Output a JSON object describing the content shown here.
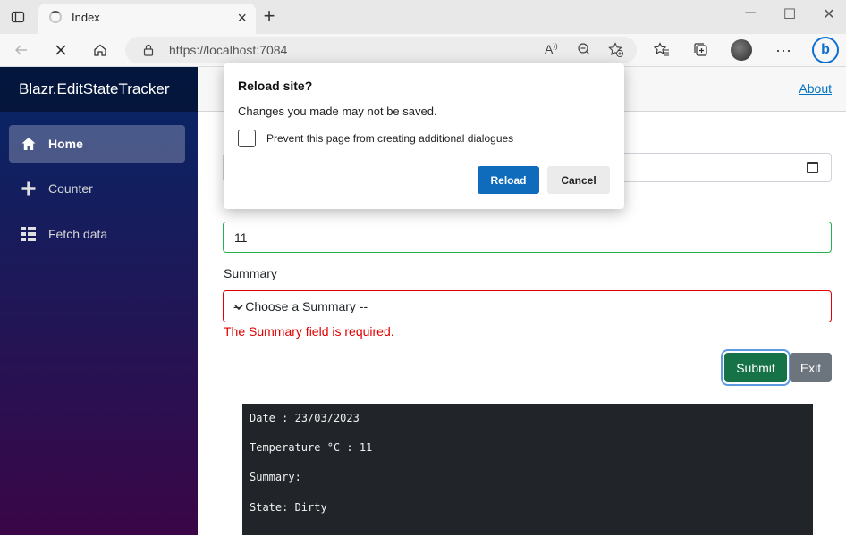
{
  "browser": {
    "tab_title": "Index",
    "url": "https://localhost:7084",
    "window_controls": {
      "minimize": "─",
      "maximize": "☐",
      "close": "✕"
    }
  },
  "app": {
    "brand": "Blazr.EditStateTracker",
    "nav": [
      {
        "label": "Home",
        "icon": "home-icon",
        "active": true
      },
      {
        "label": "Counter",
        "icon": "plus-icon",
        "active": false
      },
      {
        "label": "Fetch data",
        "icon": "list-icon",
        "active": false
      }
    ],
    "about_link": "About"
  },
  "form": {
    "temperature_value": "11",
    "summary_label": "Summary",
    "summary_selected": "-- Choose a Summary --",
    "summary_error": "The Summary field is required.",
    "submit_label": "Submit",
    "exit_label": "Exit"
  },
  "state_output": {
    "date_line": "Date : 23/03/2023",
    "temperature_line": "Temperature °C : 11",
    "summary_line": "Summary:",
    "state_line": "State: Dirty"
  },
  "dialog": {
    "title": "Reload site?",
    "message": "Changes you made may not be saved.",
    "checkbox_label": "Prevent this page from creating additional dialogues",
    "reload_label": "Reload",
    "cancel_label": "Cancel"
  },
  "colors": {
    "sidebar_top": "#052767",
    "sidebar_bottom": "#3a0647",
    "valid_border": "#26b050",
    "invalid_border": "#e30000",
    "submit_bg": "#157347",
    "exit_bg": "#6c757d",
    "dialog_primary": "#0f6cbd"
  }
}
